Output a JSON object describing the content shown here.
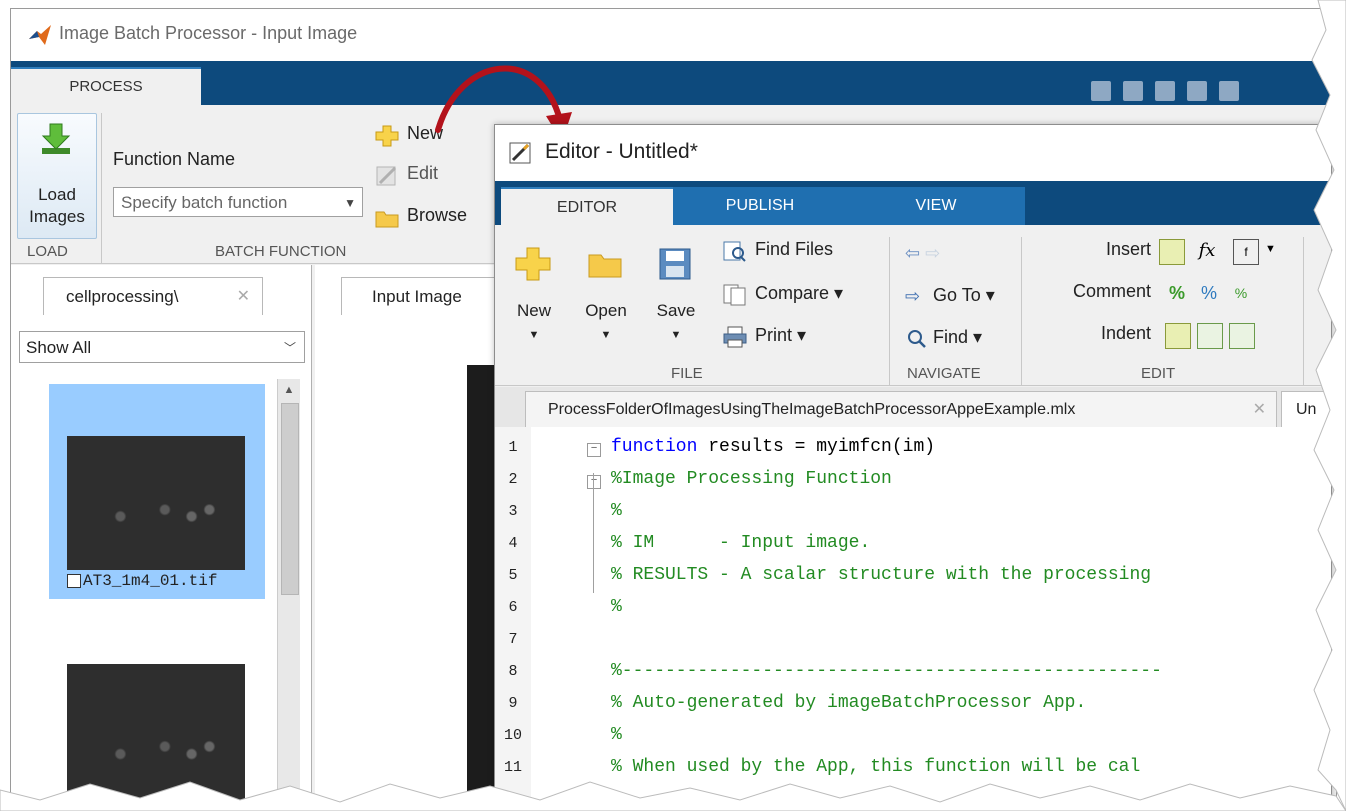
{
  "ibp": {
    "window_title": "Image Batch Processor - Input Image",
    "process_tab": "PROCESS",
    "load_images_label": "Load\nImages",
    "load_group": "LOAD",
    "function_name_label": "Function Name",
    "function_placeholder": "Specify batch function",
    "new_label": "New",
    "edit_label": "Edit",
    "browse_label": "Browse",
    "batch_function_group": "BATCH FUNCTION",
    "left_tab_label": "cellprocessing\\",
    "show_filter": "Show All",
    "thumb1_name": "AT3_1m4_01.tif",
    "mid_tab_label": "Input Image"
  },
  "editor": {
    "window_title": "Editor - Untitled*",
    "tabs": [
      "EDITOR",
      "PUBLISH",
      "VIEW"
    ],
    "new_label": "New",
    "open_label": "Open",
    "save_label": "Save",
    "find_files_label": "Find Files",
    "compare_label": "Compare",
    "print_label": "Print",
    "file_group": "FILE",
    "go_to_label": "Go To",
    "find_label": "Find",
    "navigate_group": "NAVIGATE",
    "insert_label": "Insert",
    "comment_label": "Comment",
    "indent_label": "Indent",
    "edit_group": "EDIT",
    "file_tab1": "ProcessFolderOfImagesUsingTheImageBatchProcessorAppeExample.mlx",
    "file_tab2": "Un",
    "line_numbers": [
      "1",
      "2",
      "3",
      "4",
      "5",
      "6",
      "7",
      "8",
      "9",
      "10",
      "11"
    ],
    "code": {
      "l1_kw": "function",
      "l1_rest": " results = myimfcn(im)",
      "l2": "%Image Processing Function",
      "l3": "%",
      "l4": "% IM      - Input image.",
      "l5": "% RESULTS - A scalar structure with the processing",
      "l6": "%",
      "l8": "%--------------------------------------------------",
      "l9": "% Auto-generated by imageBatchProcessor App.",
      "l10": "%",
      "l11": "% When used by the App, this function will be cal"
    }
  },
  "colors": {
    "tab_blue": "#0d4a7d",
    "selected_thumb": "#99ccff",
    "comment_green": "#228b22",
    "keyword_blue": "#0000ff",
    "arrow_red": "#b3121b"
  }
}
